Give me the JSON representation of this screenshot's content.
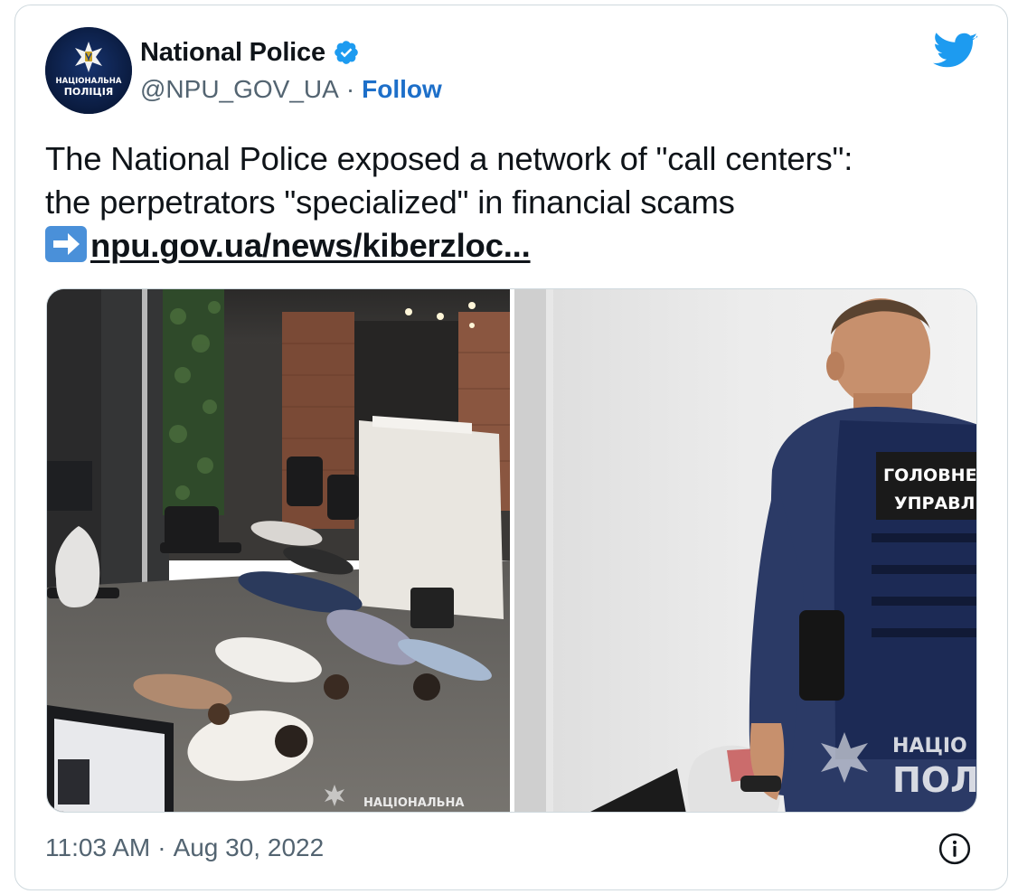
{
  "author": {
    "display_name": "National Police",
    "handle": "@NPU_GOV_UA",
    "follow_label": "Follow",
    "avatar_text_line1": "НАЦІОНАЛЬНА",
    "avatar_text_line2": "ПОЛІЦІЯ",
    "verified": true
  },
  "tweet": {
    "text_line1": "The National Police exposed a network of \"call centers\":",
    "text_line2": "the perpetrators \"specialized\" in financial scams",
    "link_text": "npu.gov.ua/news/kiberzloc...",
    "link_emoji": "arrow-right-emoji"
  },
  "media": {
    "photo_left": {
      "description_icon": "raid-office-photo",
      "watermark": "НАЦІОНАЛЬНА"
    },
    "photo_right": {
      "description_icon": "officer-photo",
      "vest_text_line1": "ГОЛОВНЕ С",
      "vest_text_line2": "УПРАВЛІ",
      "watermark_line1": "НАЦІО",
      "watermark_line2": "ПОЛ"
    }
  },
  "meta": {
    "time": "11:03 AM",
    "separator": "·",
    "date": "Aug 30, 2022"
  },
  "colors": {
    "follow": "#1d6fc9",
    "verified": "#1d9bf0",
    "twitter_bird": "#1d9bf0",
    "secondary_text": "#536471",
    "border": "#cfd9de"
  },
  "icons": {
    "bird": "twitter-bird-icon",
    "verified": "verified-badge-icon",
    "info": "info-icon"
  }
}
